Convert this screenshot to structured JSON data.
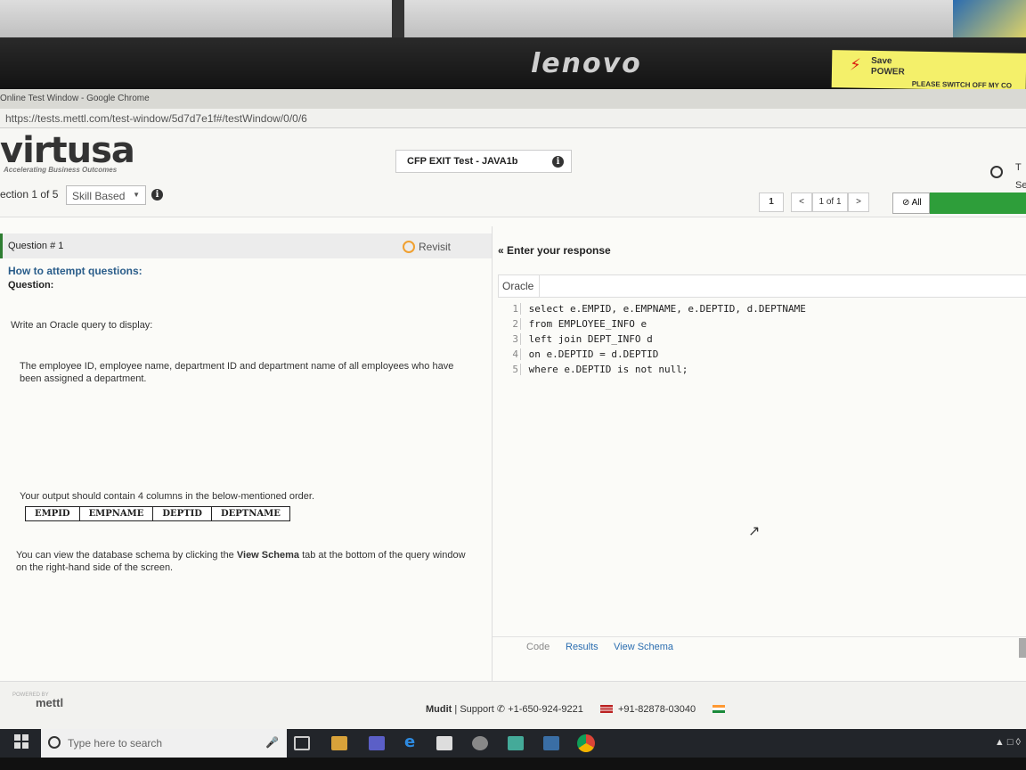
{
  "monitor": {
    "brand": "lenovo",
    "sticky_line1": "Save",
    "sticky_line2": "POWER",
    "sticky_line3": "PLEASE SWITCH OFF MY CO"
  },
  "browser": {
    "window_title": "Online Test Window - Google Chrome",
    "url": "https://tests.mettl.com/test-window/5d7d7e1f#/testWindow/0/0/6"
  },
  "header": {
    "logo": "virtusa",
    "tagline": "Accelerating Business Outcomes",
    "test_title": "CFP EXIT Test - JAVA1b",
    "section_prefix": "ection",
    "section_value": "1 of 5",
    "section_type": "Skill Based",
    "right_clip_1": "T",
    "right_clip_2": "Se",
    "page_num": "1",
    "prev": "<",
    "page_of": "1 of 1",
    "next": ">",
    "all_label": "All"
  },
  "question": {
    "heading": "Question # 1",
    "revisit": "Revisit",
    "how_to": "How to attempt questions:",
    "label": "Question:",
    "p1": "Write an Oracle query to display:",
    "p2": "The employee ID, employee name, department ID and department name of all employees who have been assigned a department.",
    "p3": "Your output should contain 4 columns in the below-mentioned order.",
    "columns": [
      "EMPID",
      "EMPNAME",
      "DEPTID",
      "DEPTNAME"
    ],
    "p4_a": "You can view the database schema by clicking the",
    "p4_b": "View Schema",
    "p4_c": "tab at the bottom of the query window on the right-hand side of the screen."
  },
  "response": {
    "heading": "Enter your response",
    "language": "Oracle",
    "code_lines": [
      "select e.EMPID, e.EMPNAME, e.DEPTID, d.DEPTNAME",
      "from EMPLOYEE_INFO e",
      "left join DEPT_INFO d",
      "on e.DEPTID = d.DEPTID",
      "where e.DEPTID is not null;"
    ],
    "tabs": [
      "Code",
      "Results",
      "View Schema"
    ]
  },
  "footer": {
    "powered": "POWERED BY",
    "mettl": "mettl",
    "mudit": "Mudit",
    "support": "Support",
    "phone_us": "+1-650-924-9221",
    "phone_in": "+91-82878-03040"
  },
  "taskbar": {
    "search_placeholder": "Type here to search"
  },
  "colors": {
    "accent_green": "#2e9e3a",
    "link_blue": "#2a5d8a",
    "keyword_blue": "#1a56c9"
  }
}
